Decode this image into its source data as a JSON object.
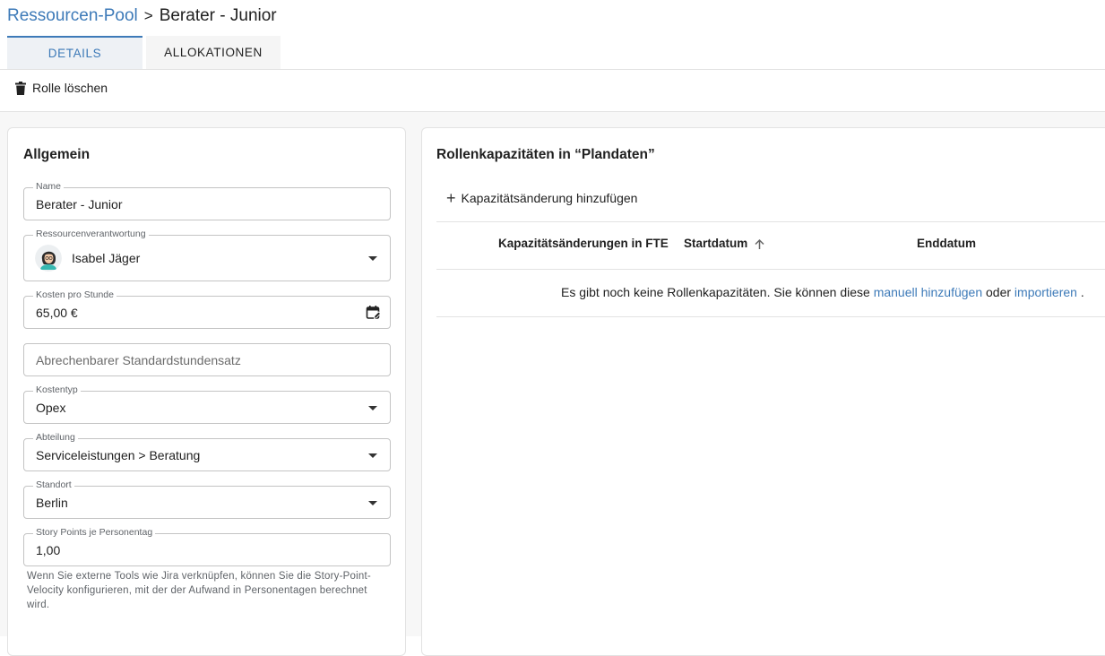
{
  "breadcrumb": {
    "parent": "Ressourcen-Pool",
    "separator": ">",
    "current": "Berater - Junior"
  },
  "tabs": [
    {
      "label": "DETAILS",
      "active": true
    },
    {
      "label": "ALLOKATIONEN",
      "active": false
    }
  ],
  "toolbar": {
    "delete_label": "Rolle löschen",
    "delete_icon": "trash-icon"
  },
  "general": {
    "title": "Allgemein",
    "name": {
      "label": "Name",
      "value": "Berater - Junior"
    },
    "owner": {
      "label": "Ressourcenverantwortung",
      "value": "Isabel Jäger"
    },
    "cost_per_hour": {
      "label": "Kosten pro Stunde",
      "value": "65,00 €"
    },
    "billable_rate": {
      "placeholder": "Abrechenbarer Standardstundensatz"
    },
    "cost_type": {
      "label": "Kostentyp",
      "value": "Opex"
    },
    "department": {
      "label": "Abteilung",
      "value": "Serviceleistungen > Beratung"
    },
    "location": {
      "label": "Standort",
      "value": "Berlin"
    },
    "story_points": {
      "label": "Story Points je Personentag",
      "value": "1,00"
    },
    "helper_text": "Wenn Sie externe Tools wie Jira verknüpfen, können Sie die Story-Point-Velocity konfigurieren, mit der der Aufwand in Personentagen berechnet wird."
  },
  "capacities": {
    "title": "Rollenkapazitäten in “Plandaten”",
    "add_label": "Kapazitätsänderung hinzufügen",
    "columns": [
      "Kapazitätsänderungen in FTE",
      "Startdatum",
      "Enddatum"
    ],
    "empty_prefix": "Es gibt noch keine Rollenkapazitäten. Sie können diese",
    "empty_link1": "manuell hinzufügen",
    "empty_middle": "oder",
    "empty_link2": "importieren",
    "empty_suffix": "."
  },
  "colors": {
    "accent": "#3d7ab8",
    "text": "#212121",
    "muted": "#5f6368"
  }
}
